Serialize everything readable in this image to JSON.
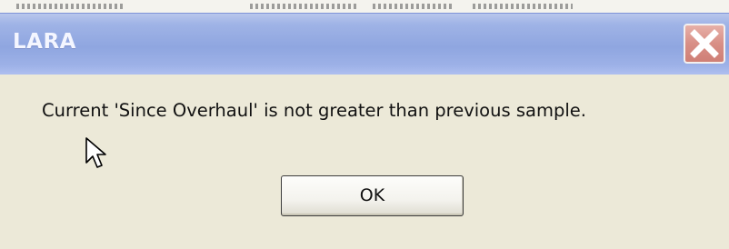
{
  "window": {
    "title": "LARA",
    "close_icon": "close-x-icon"
  },
  "dialog": {
    "message": "Current 'Since Overhaul' is not greater than previous sample.",
    "ok_label": "OK"
  },
  "pointer": {
    "icon": "mouse-pointer-arrow-icon"
  },
  "colors": {
    "dialog_background": "#ece9d8",
    "titlebar": "#9fb3e6",
    "close_button": "#d88f86"
  }
}
